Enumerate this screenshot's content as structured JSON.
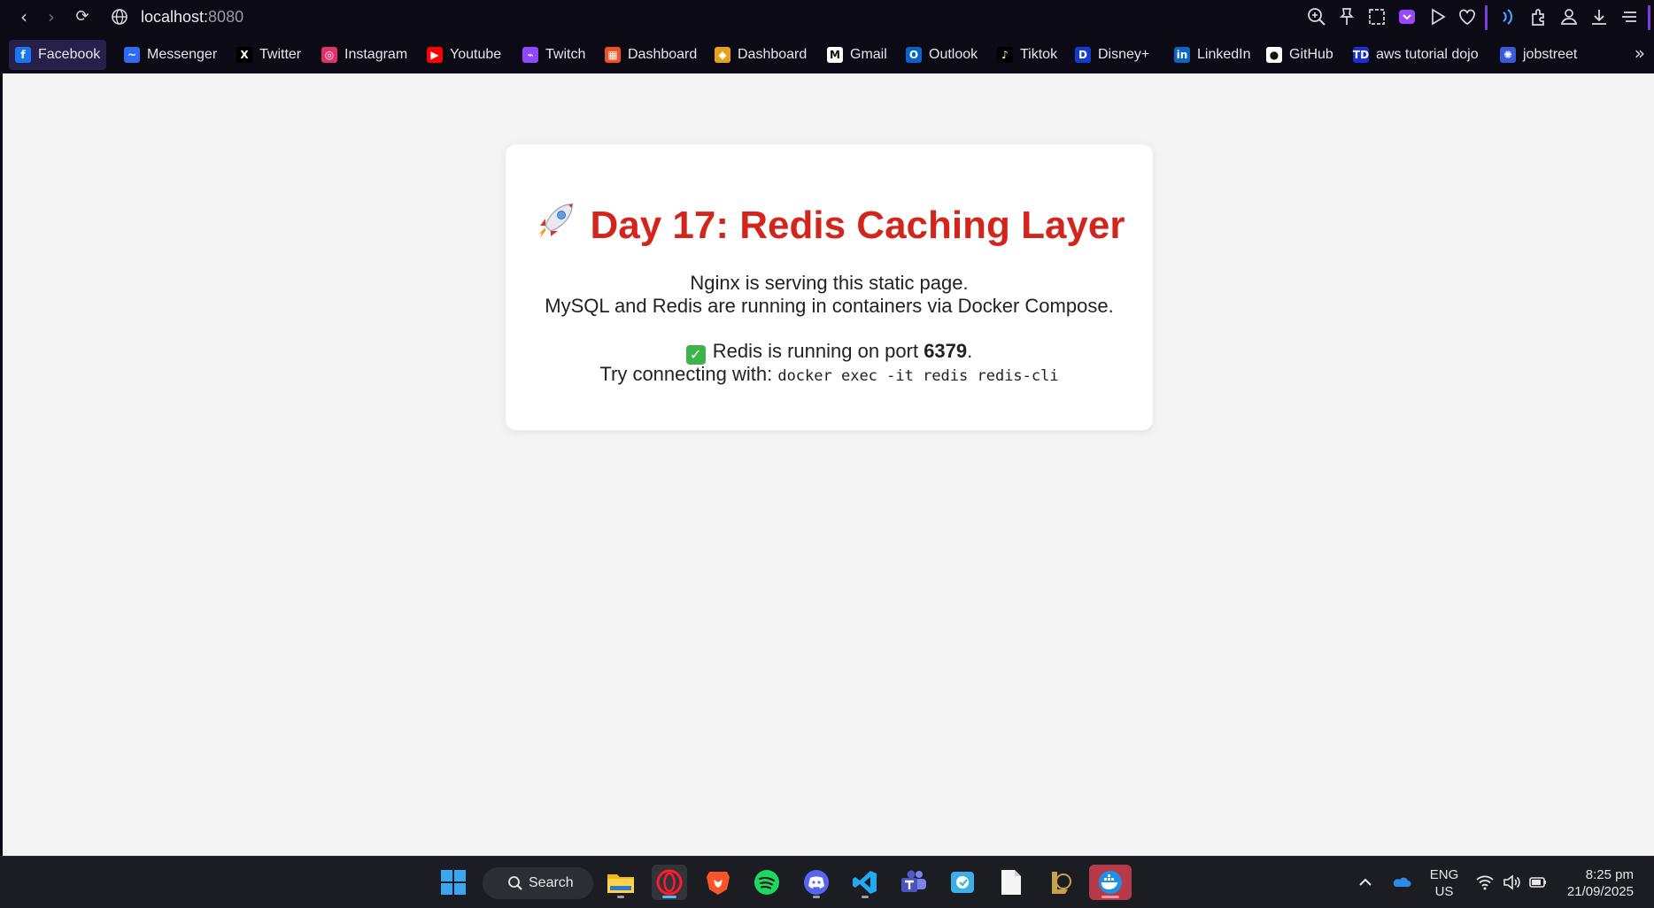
{
  "browser": {
    "url_host": "localhost:",
    "url_port": "8080",
    "bookmarks": [
      {
        "label": "Facebook",
        "icon": "facebook-icon",
        "color": "#1877f2",
        "glyph": "f"
      },
      {
        "label": "Messenger",
        "icon": "messenger-icon",
        "color": "#2e6cf6",
        "glyph": "~"
      },
      {
        "label": "Twitter",
        "icon": "x-twitter-icon",
        "color": "#000000",
        "glyph": "X"
      },
      {
        "label": "Instagram",
        "icon": "instagram-icon",
        "color": "#e1306c",
        "glyph": "◎"
      },
      {
        "label": "Youtube",
        "icon": "youtube-icon",
        "color": "#ff0000",
        "glyph": "▶"
      },
      {
        "label": "Twitch",
        "icon": "twitch-icon",
        "color": "#9146ff",
        "glyph": "⌁"
      },
      {
        "label": "Dashboard",
        "icon": "windows-dashboard-icon",
        "color": "#f25022",
        "glyph": "▦"
      },
      {
        "label": "Dashboard",
        "icon": "box-dashboard-icon",
        "color": "#e7a21b",
        "glyph": "◆"
      },
      {
        "label": "Gmail",
        "icon": "gmail-icon",
        "color": "#ffffff",
        "glyph": "M"
      },
      {
        "label": "Outlook",
        "icon": "outlook-icon",
        "color": "#0a64c8",
        "glyph": "O"
      },
      {
        "label": "Tiktok",
        "icon": "tiktok-icon",
        "color": "#000000",
        "glyph": "♪"
      },
      {
        "label": "Disney+",
        "icon": "disney-plus-icon",
        "color": "#113ccf",
        "glyph": "D"
      },
      {
        "label": "LinkedIn",
        "icon": "linkedin-icon",
        "color": "#0a66c2",
        "glyph": "in"
      },
      {
        "label": "GitHub",
        "icon": "github-icon",
        "color": "#ffffff",
        "glyph": "●"
      },
      {
        "label": "aws tutorial dojo",
        "icon": "tutorial-dojo-icon",
        "color": "#1a2fd6",
        "glyph": "TD"
      },
      {
        "label": "jobstreet",
        "icon": "jobstreet-icon",
        "color": "#3a5bd9",
        "glyph": "✺"
      }
    ]
  },
  "page": {
    "title": "Day 17: Redis Caching Layer",
    "line1": "Nginx is serving this static page.",
    "line2": "MySQL and Redis are running in containers via Docker Compose.",
    "status_prefix": "Redis is running on port ",
    "status_port": "6379",
    "status_suffix": ".",
    "try_label": "Try connecting with: ",
    "try_command": "docker exec -it redis redis-cli"
  },
  "taskbar": {
    "search_label": "Search",
    "lang_line1": "ENG",
    "lang_line2": "US",
    "time": "8:25 pm",
    "date": "21/09/2025"
  },
  "colors": {
    "title_red": "#d2261d",
    "chrome_bg": "#0c0a14",
    "accent_purple": "#7b3fe4"
  }
}
